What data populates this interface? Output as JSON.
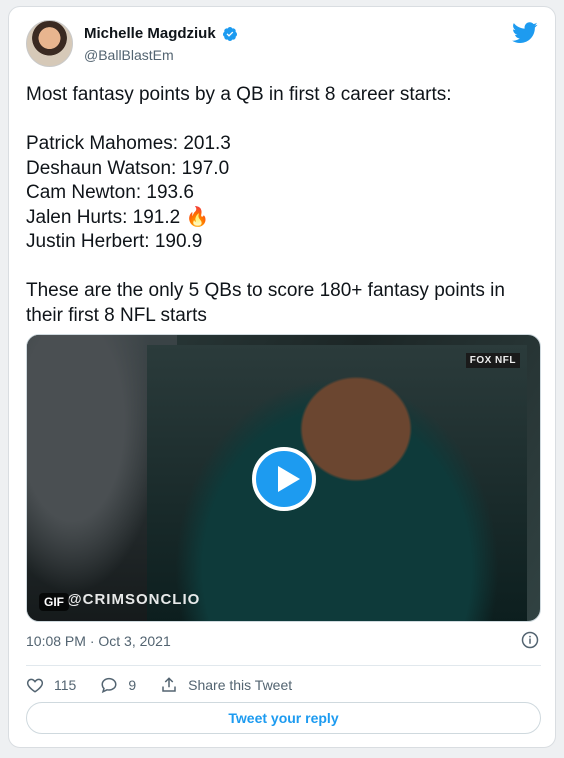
{
  "tweet": {
    "author_name": "Michelle Magdziuk",
    "handle": "@BallBlastEm",
    "lines": [
      "Most fantasy points by a QB in first 8 career starts:",
      "",
      "Patrick Mahomes: 201.3",
      "Deshaun Watson: 197.0",
      "Cam Newton: 193.6",
      "Jalen Hurts: 191.2 🔥",
      "Justin Herbert: 190.9",
      "",
      "These are the only 5 QBs to score 180+ fantasy points in their first 8 NFL starts"
    ],
    "media": {
      "gif_label": "GIF",
      "watermark": "@CRIMSONCLIO",
      "network_logo": "FOX NFL"
    },
    "timestamp": "10:08 PM · Oct 3, 2021",
    "likes": "115",
    "replies": "9",
    "share_label": "Share this Tweet",
    "reply_button_label": "Tweet your reply"
  },
  "colors": {
    "accent": "#1d9bf0",
    "like": "#536471",
    "text": "#0f1419",
    "muted": "#536471"
  },
  "icons": [
    "verified-badge-icon",
    "twitter-bird-icon",
    "play-icon",
    "info-icon",
    "heart-icon",
    "reply-icon",
    "share-icon"
  ]
}
